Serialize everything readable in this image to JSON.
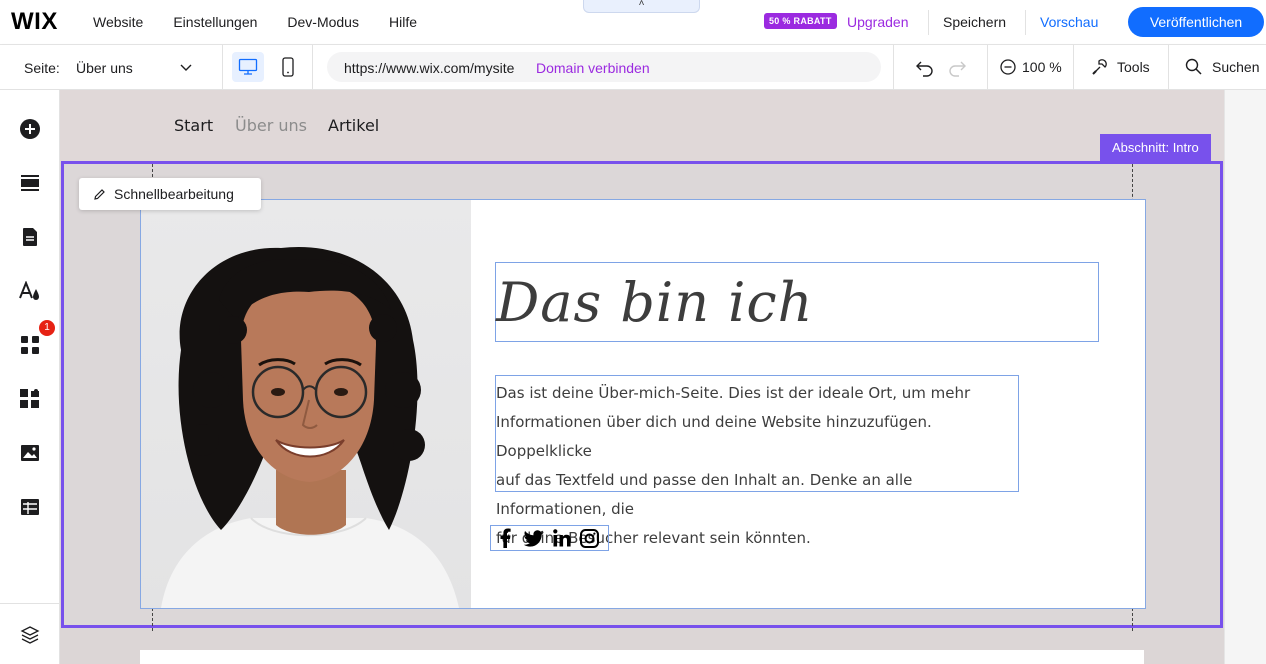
{
  "topbar": {
    "logo": "WIX",
    "menu": [
      "Website",
      "Einstellungen",
      "Dev-Modus",
      "Hilfe"
    ],
    "collapse": "˄",
    "promo": "50 % RABATT",
    "upgrade": "Upgraden",
    "save": "Speichern",
    "preview": "Vorschau",
    "publish": "Veröffentlichen"
  },
  "subbar": {
    "page_label": "Seite:",
    "page_value": "Über uns",
    "url": "https://www.wix.com/mysite",
    "connect": "Domain verbinden",
    "zoom": "100 %",
    "tools": "Tools",
    "search": "Suchen"
  },
  "sidebar": {
    "icons": [
      "add-icon",
      "sections-icon",
      "pages-icon",
      "design-icon",
      "apps-icon",
      "business-apps-icon",
      "media-icon",
      "cms-icon",
      "layers-icon"
    ],
    "apps_badge": "1"
  },
  "site": {
    "nav": [
      "Start",
      "Über uns",
      "Artikel"
    ],
    "active_nav": "Über uns",
    "section_tag": "Abschnitt: Intro",
    "quick_edit": "Schnellbearbeitung",
    "title": "Das bin ich",
    "paragraph_lines": [
      "Das ist deine Über-mich-Seite. Dies ist der ideale Ort, um mehr",
      "Informationen über dich und deine Website hinzuzufügen. Doppelklicke",
      "auf das Textfeld und passe den Inhalt an. Denke an alle Informationen, die",
      "für deine Besucher relevant sein könnten."
    ],
    "social": [
      "facebook-icon",
      "twitter-icon",
      "linkedin-icon",
      "instagram-icon"
    ]
  },
  "colors": {
    "accent": "#116dff",
    "upgrade": "#9b2ae0",
    "section": "#7851ec",
    "badge": "#e62214"
  }
}
